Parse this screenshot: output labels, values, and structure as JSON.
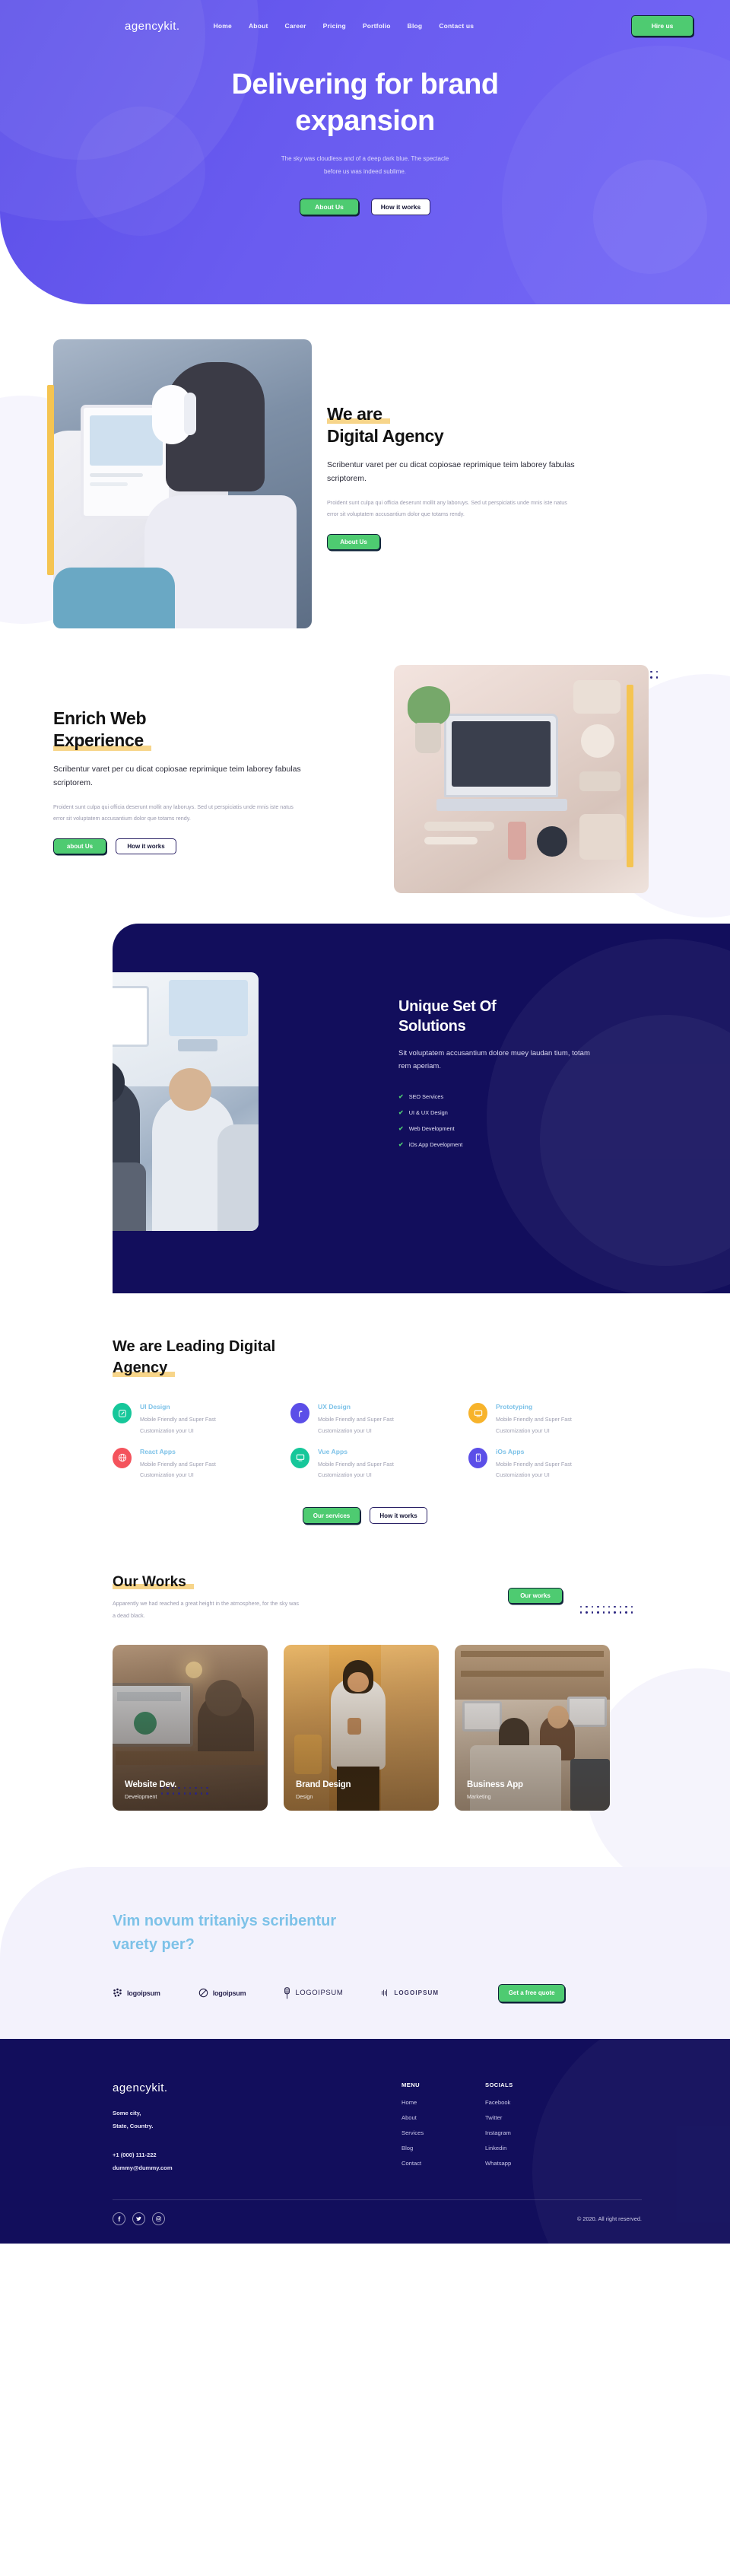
{
  "brand": "agencykit.",
  "nav": {
    "links": [
      "Home",
      "About",
      "Career",
      "Pricing",
      "Portfolio",
      "Blog",
      "Contact us"
    ],
    "cta": "Hire us"
  },
  "hero": {
    "title_line1": "Delivering for brand",
    "title_line2": "expansion",
    "subtitle_line1": "The sky was cloudless and of a deep dark blue. The spectacle",
    "subtitle_line2": "before us was indeed sublime.",
    "btn_primary": "About Us",
    "btn_secondary": "How it works"
  },
  "digital": {
    "title_hl": "We are",
    "title_rest": "Digital Agency",
    "lead": "Scribentur varet per cu dicat copiosae reprimique teim laborey fabulas scriptorem.",
    "muted": "Proident sunt culpa qui officia deserunt mollit any laboruys. Sed ut perspiciatis unde mnis iste natus error sit voluptatem accusantium dolor que totams rendy.",
    "btn_primary": "About Us"
  },
  "enrich": {
    "title_line1": "Enrich Web",
    "title_hl": "Experience",
    "lead": "Scribentur varet per cu dicat copiosae reprimique teim laborey fabulas scriptorem.",
    "muted": "Proident sunt culpa qui officia deserunt mollit any laboruys. Sed ut perspiciatis unde mnis iste natus error sit voluptatem accusantium dolor que totams rendy.",
    "btn_primary": "about Us",
    "btn_secondary": "How it works"
  },
  "solutions": {
    "title_line1": "Unique Set Of",
    "title_line2": "Solutions",
    "lead": "Sit voluptatem accusantium dolore muey laudan tium, totam rem aperiam.",
    "items": [
      "SEO Services",
      "UI & UX Design",
      "Web Development",
      "iOs App Development"
    ]
  },
  "services": {
    "title_line1": "We are Leading Digital",
    "title_hl": "Agency",
    "cards": [
      {
        "title": "UI Design",
        "desc_line1": "Mobile Friendly and Super Fast",
        "desc_line2": "Customization your UI",
        "icon": "pencil-square-icon",
        "color": "#16c79a"
      },
      {
        "title": "UX Design",
        "desc_line1": "Mobile Friendly and Super Fast",
        "desc_line2": "Customization your UI",
        "icon": "arrow-route-icon",
        "color": "#5b4ee8"
      },
      {
        "title": "Prototyping",
        "desc_line1": "Mobile Friendly and Super Fast",
        "desc_line2": "Customization your UI",
        "icon": "monitor-icon",
        "color": "#f7b32b"
      },
      {
        "title": "React Apps",
        "desc_line1": "Mobile Friendly and Super Fast",
        "desc_line2": "Customization your UI",
        "icon": "globe-icon",
        "color": "#f4535c"
      },
      {
        "title": "Vue Apps",
        "desc_line1": "Mobile Friendly and Super Fast",
        "desc_line2": "Customization your UI",
        "icon": "monitor-icon",
        "color": "#16c79a"
      },
      {
        "title": "iOs Apps",
        "desc_line1": "Mobile Friendly and Super Fast",
        "desc_line2": "Customization your UI",
        "icon": "mobile-icon",
        "color": "#5b4ee8"
      }
    ],
    "btn_primary": "Our services",
    "btn_secondary": "How it works"
  },
  "works": {
    "title_hl": "Our Works",
    "sub_line1": "Apparently we had reached a great height in the atmosphere, for the",
    "sub_line2": "sky was a dead black.",
    "btn": "Our works",
    "cards": [
      {
        "title": "Website Dev.",
        "category": "Development"
      },
      {
        "title": "Brand Design",
        "category": "Design"
      },
      {
        "title": "Business App",
        "category": "Marketing"
      }
    ]
  },
  "cta": {
    "title_line1": "Vim novum tritaniys scribentur",
    "title_line2": "varety per?",
    "logos": [
      "logoipsum",
      "logoipsum",
      "LOGOIPSUM",
      "LOGOIPSUM"
    ],
    "button": "Get a free quote"
  },
  "footer": {
    "brand": "agencykit.",
    "address_line1": "Some city,",
    "address_line2": "State, Country.",
    "phone": "+1 (000) 111-222",
    "email": "dummy@dummy.com",
    "menu_title": "MENU",
    "menu_links": [
      "Home",
      "About",
      "Services",
      "Blog",
      "Contact"
    ],
    "socials_title": "SOCIALS",
    "socials_links": [
      "Facebook",
      "Twitter",
      "Instagram",
      "Linkedin",
      "Whatsapp"
    ],
    "social_icons": [
      "facebook-icon",
      "twitter-icon",
      "instagram-icon"
    ],
    "copyright": "© 2020. All right reserved."
  },
  "colors": {
    "purple": "#5b4ee8",
    "green": "#4ecb71",
    "navy": "#120e5c",
    "yellow": "#f5c451",
    "sky": "#7dc2e8"
  }
}
